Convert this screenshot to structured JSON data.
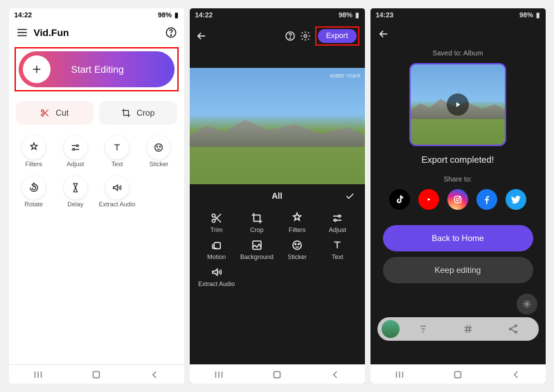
{
  "screen1": {
    "status": {
      "time": "14:22",
      "battery": "98%",
      "icons": "⬚ ⬚ ▪"
    },
    "app_title": "Vid.Fun",
    "start_label": "Start Editing",
    "quick": {
      "cut": "Cut",
      "crop": "Crop"
    },
    "tools": [
      {
        "id": "filters",
        "label": "Filters"
      },
      {
        "id": "adjust",
        "label": "Adjust"
      },
      {
        "id": "text",
        "label": "Text"
      },
      {
        "id": "sticker",
        "label": "Sticker"
      },
      {
        "id": "rotate",
        "label": "Rotate"
      },
      {
        "id": "delay",
        "label": "Delay"
      },
      {
        "id": "extract-audio",
        "label": "Extract Audio"
      }
    ]
  },
  "screen2": {
    "status": {
      "time": "14:22",
      "battery": "98%"
    },
    "export_label": "Export",
    "watermark": "water mark",
    "tab_label": "All",
    "tools": [
      {
        "id": "trim",
        "label": "Trim"
      },
      {
        "id": "crop",
        "label": "Crop"
      },
      {
        "id": "filters",
        "label": "Filters"
      },
      {
        "id": "adjust",
        "label": "Adjust"
      },
      {
        "id": "motion",
        "label": "Motion"
      },
      {
        "id": "background",
        "label": "Background"
      },
      {
        "id": "sticker",
        "label": "Sticker"
      },
      {
        "id": "text",
        "label": "Text"
      },
      {
        "id": "extract-audio",
        "label": "Extract Audio"
      }
    ]
  },
  "screen3": {
    "status": {
      "time": "14:23",
      "battery": "98%"
    },
    "saved_to": "Saved to: Album",
    "completed": "Export completed!",
    "share_label": "Share to:",
    "share": [
      {
        "id": "tiktok",
        "bg": "#000",
        "fg": "#fff"
      },
      {
        "id": "youtube",
        "bg": "#ff0000",
        "fg": "#fff"
      },
      {
        "id": "instagram",
        "bg": "radial-gradient(circle at 30% 110%,#fdf497 0%,#fd5949 45%,#d6249f 60%,#285AEB 90%)",
        "fg": "#fff"
      },
      {
        "id": "facebook",
        "bg": "#1877f2",
        "fg": "#fff"
      },
      {
        "id": "twitter",
        "bg": "#1da1f2",
        "fg": "#fff"
      }
    ],
    "btn_primary": "Back to Home",
    "btn_secondary": "Keep editing"
  }
}
